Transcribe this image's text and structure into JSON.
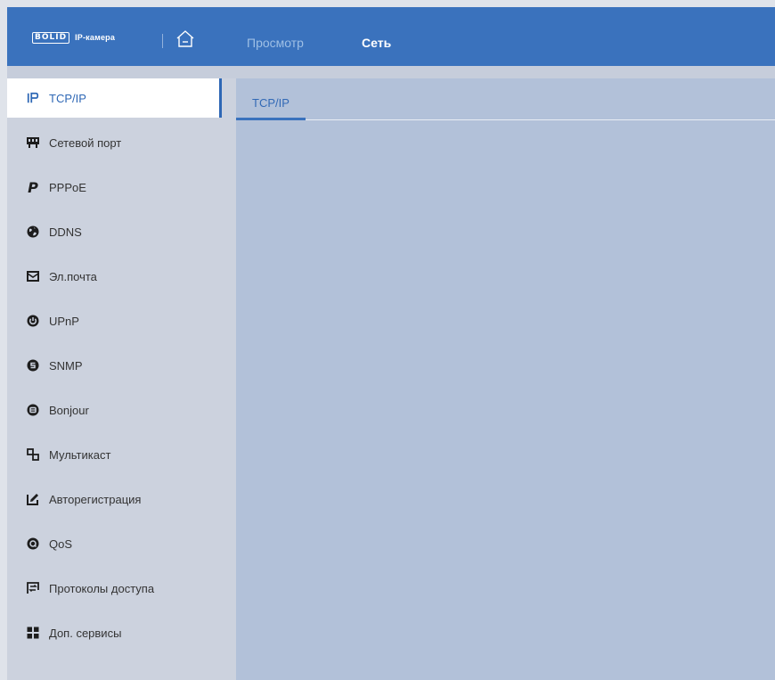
{
  "header": {
    "logo_brand": "BOLID",
    "logo_text": "IP-камера",
    "nav": [
      {
        "label": "Просмотр",
        "active": false
      },
      {
        "label": "Сеть",
        "active": true
      }
    ]
  },
  "sidebar": {
    "items": [
      {
        "label": "TCP/IP",
        "icon": "ip-icon",
        "active": true
      },
      {
        "label": "Сетевой порт",
        "icon": "network-port-icon"
      },
      {
        "label": "PPPoE",
        "icon": "pppoe-icon"
      },
      {
        "label": "DDNS",
        "icon": "globe-icon"
      },
      {
        "label": "Эл.почта",
        "icon": "mail-icon"
      },
      {
        "label": "UPnP",
        "icon": "power-icon"
      },
      {
        "label": "SNMP",
        "icon": "snmp-icon"
      },
      {
        "label": "Bonjour",
        "icon": "bonjour-icon"
      },
      {
        "label": "Мультикаст",
        "icon": "multicast-icon"
      },
      {
        "label": "Авторегистрация",
        "icon": "autoregister-icon"
      },
      {
        "label": "QoS",
        "icon": "qos-icon"
      },
      {
        "label": "Протоколы доступа",
        "icon": "access-protocols-icon"
      },
      {
        "label": "Доп. сервисы",
        "icon": "services-grid-icon"
      }
    ]
  },
  "main": {
    "tabs": [
      {
        "label": "TCP/IP",
        "active": true
      }
    ]
  },
  "colors": {
    "header": "#3a72bd",
    "accent": "#2e67b5",
    "sidebar": "#ccd2de",
    "content": "#b2c1d9"
  }
}
